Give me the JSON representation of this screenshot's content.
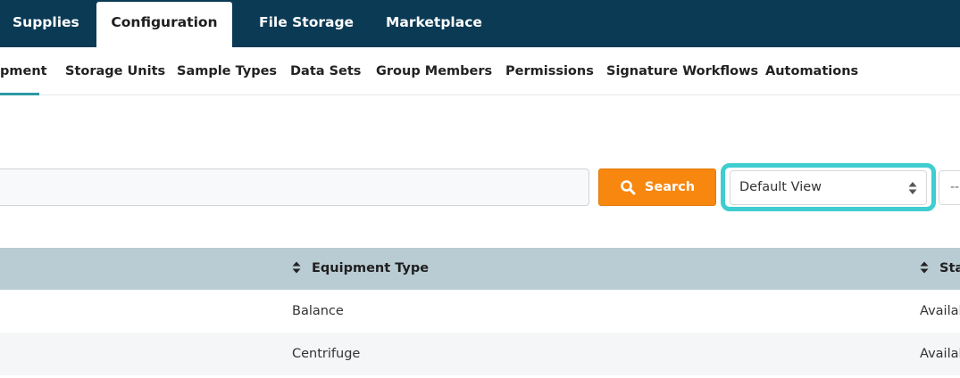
{
  "top_nav": {
    "tabs": [
      {
        "label": "Supplies",
        "active": false
      },
      {
        "label": "Configuration",
        "active": true
      },
      {
        "label": "File Storage",
        "active": false
      },
      {
        "label": "Marketplace",
        "active": false
      }
    ]
  },
  "sub_nav": {
    "tabs": [
      {
        "label": "pment",
        "active": true
      },
      {
        "label": "Storage Units",
        "active": false
      },
      {
        "label": "Sample Types",
        "active": false
      },
      {
        "label": "Data Sets",
        "active": false
      },
      {
        "label": "Group Members",
        "active": false
      },
      {
        "label": "Permissions",
        "active": false
      },
      {
        "label": "Signature Workflows",
        "active": false
      },
      {
        "label": "Automations",
        "active": false
      }
    ]
  },
  "search": {
    "value": "",
    "placeholder": "",
    "button_label": "Search",
    "button_color": "#f7870f"
  },
  "view_select": {
    "selected": "Default View",
    "highlight_color": "#3fcdd0"
  },
  "partial_select": {
    "text": "--"
  },
  "table": {
    "columns": [
      "Equipment Type",
      "Sta"
    ],
    "rows": [
      {
        "equipment_type": "Balance",
        "status": "Availal"
      },
      {
        "equipment_type": "Centrifuge",
        "status": "Availal"
      }
    ],
    "header_bg": "#b9cbd3"
  },
  "icons": {
    "search_button": "search-icon",
    "select_arrows": "sort-arrows-icon",
    "column_sort": "sort-icon"
  }
}
